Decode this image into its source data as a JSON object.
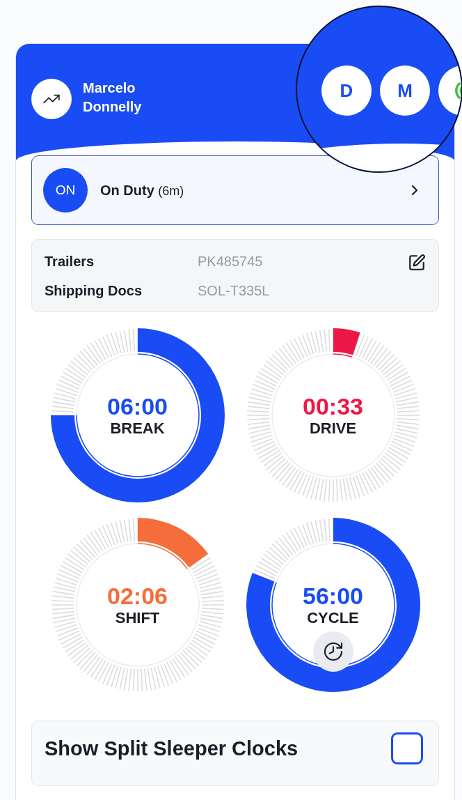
{
  "driver": {
    "name": "Marcelo Donnelly"
  },
  "header_buttons": [
    {
      "kind": "letter",
      "label": "D"
    },
    {
      "kind": "letter",
      "label": "M"
    },
    {
      "kind": "signal"
    }
  ],
  "duty": {
    "badge": "ON",
    "status": "On Duty",
    "duration": "(6m)"
  },
  "details": [
    {
      "label": "Trailers",
      "value": "PK485745"
    },
    {
      "label": "Shipping Docs",
      "value": "SOL-T335L"
    }
  ],
  "clocks": [
    {
      "kind": "plain",
      "time": "06:00",
      "label": "BREAK",
      "color": "#1a4cf5"
    },
    {
      "kind": "plain",
      "time": "00:33",
      "label": "DRIVE",
      "color": "#ee1846"
    },
    {
      "kind": "plain",
      "time": "02:06",
      "label": "SHIFT",
      "color": "#f46d3a"
    },
    {
      "kind": "history",
      "time": "56:00",
      "label": "CYCLE",
      "color": "#1a4cf5"
    }
  ],
  "split_sleeper": {
    "label": "Show Split Sleeper Clocks",
    "checked": false
  }
}
